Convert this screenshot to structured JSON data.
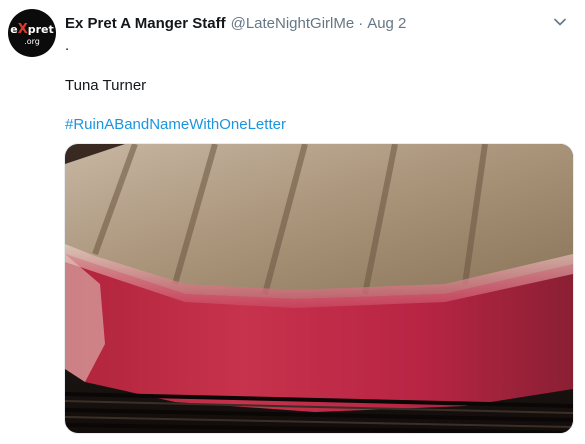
{
  "tweet": {
    "display_name": "Ex Pret A Manger Staff",
    "handle": "@LateNightGirlMe",
    "separator": "·",
    "date": "Aug 2",
    "text_line_1": ".",
    "text_line_2": "Tuna Turner",
    "hashtag": "#RuinABandNameWithOneLetter"
  },
  "avatar": {
    "brand_e": "e",
    "brand_x": "X",
    "brand_rest": "pret",
    "brand_domain": ".org"
  },
  "icons": {
    "menu": "chevron-down-icon"
  },
  "colors": {
    "text": "#14171a",
    "muted": "#657786",
    "link": "#1b95e0",
    "brand_accent": "#e03a2f"
  }
}
